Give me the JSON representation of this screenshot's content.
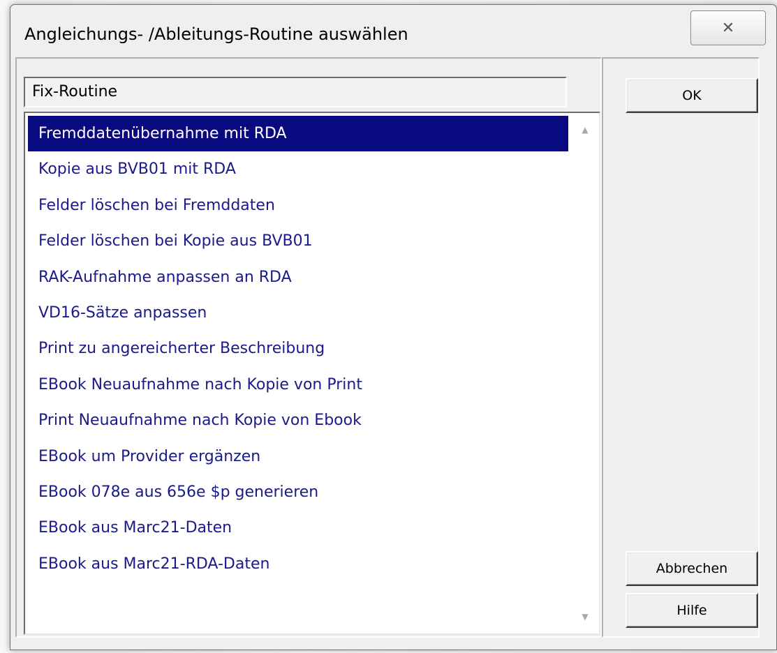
{
  "dialog": {
    "title": "Angleichungs- /Ableitungs-Routine auswählen",
    "close_glyph": "✕"
  },
  "combo": {
    "selected_value": "Fix-Routine"
  },
  "list": {
    "items": [
      "Fremddatenübernahme mit RDA",
      "Kopie aus BVB01 mit RDA",
      "Felder löschen bei Fremddaten",
      "Felder löschen bei Kopie aus BVB01",
      "RAK-Aufnahme anpassen an RDA",
      "VD16-Sätze anpassen",
      "Print zu angereicherter Beschreibung",
      "EBook Neuaufnahme nach Kopie von Print",
      "Print Neuaufnahme nach Kopie von Ebook",
      "EBook um Provider ergänzen",
      "EBook 078e aus 656e $p generieren",
      "EBook aus Marc21-Daten",
      "EBook aus Marc21-RDA-Daten"
    ],
    "selected_index": 0,
    "scroll_up_glyph": "▲",
    "scroll_down_glyph": "▼"
  },
  "buttons": {
    "ok": "OK",
    "cancel": "Abbrechen",
    "help": "Hilfe"
  },
  "colors": {
    "selection_bg": "#0a0a80",
    "item_text": "#1a1a8c"
  }
}
